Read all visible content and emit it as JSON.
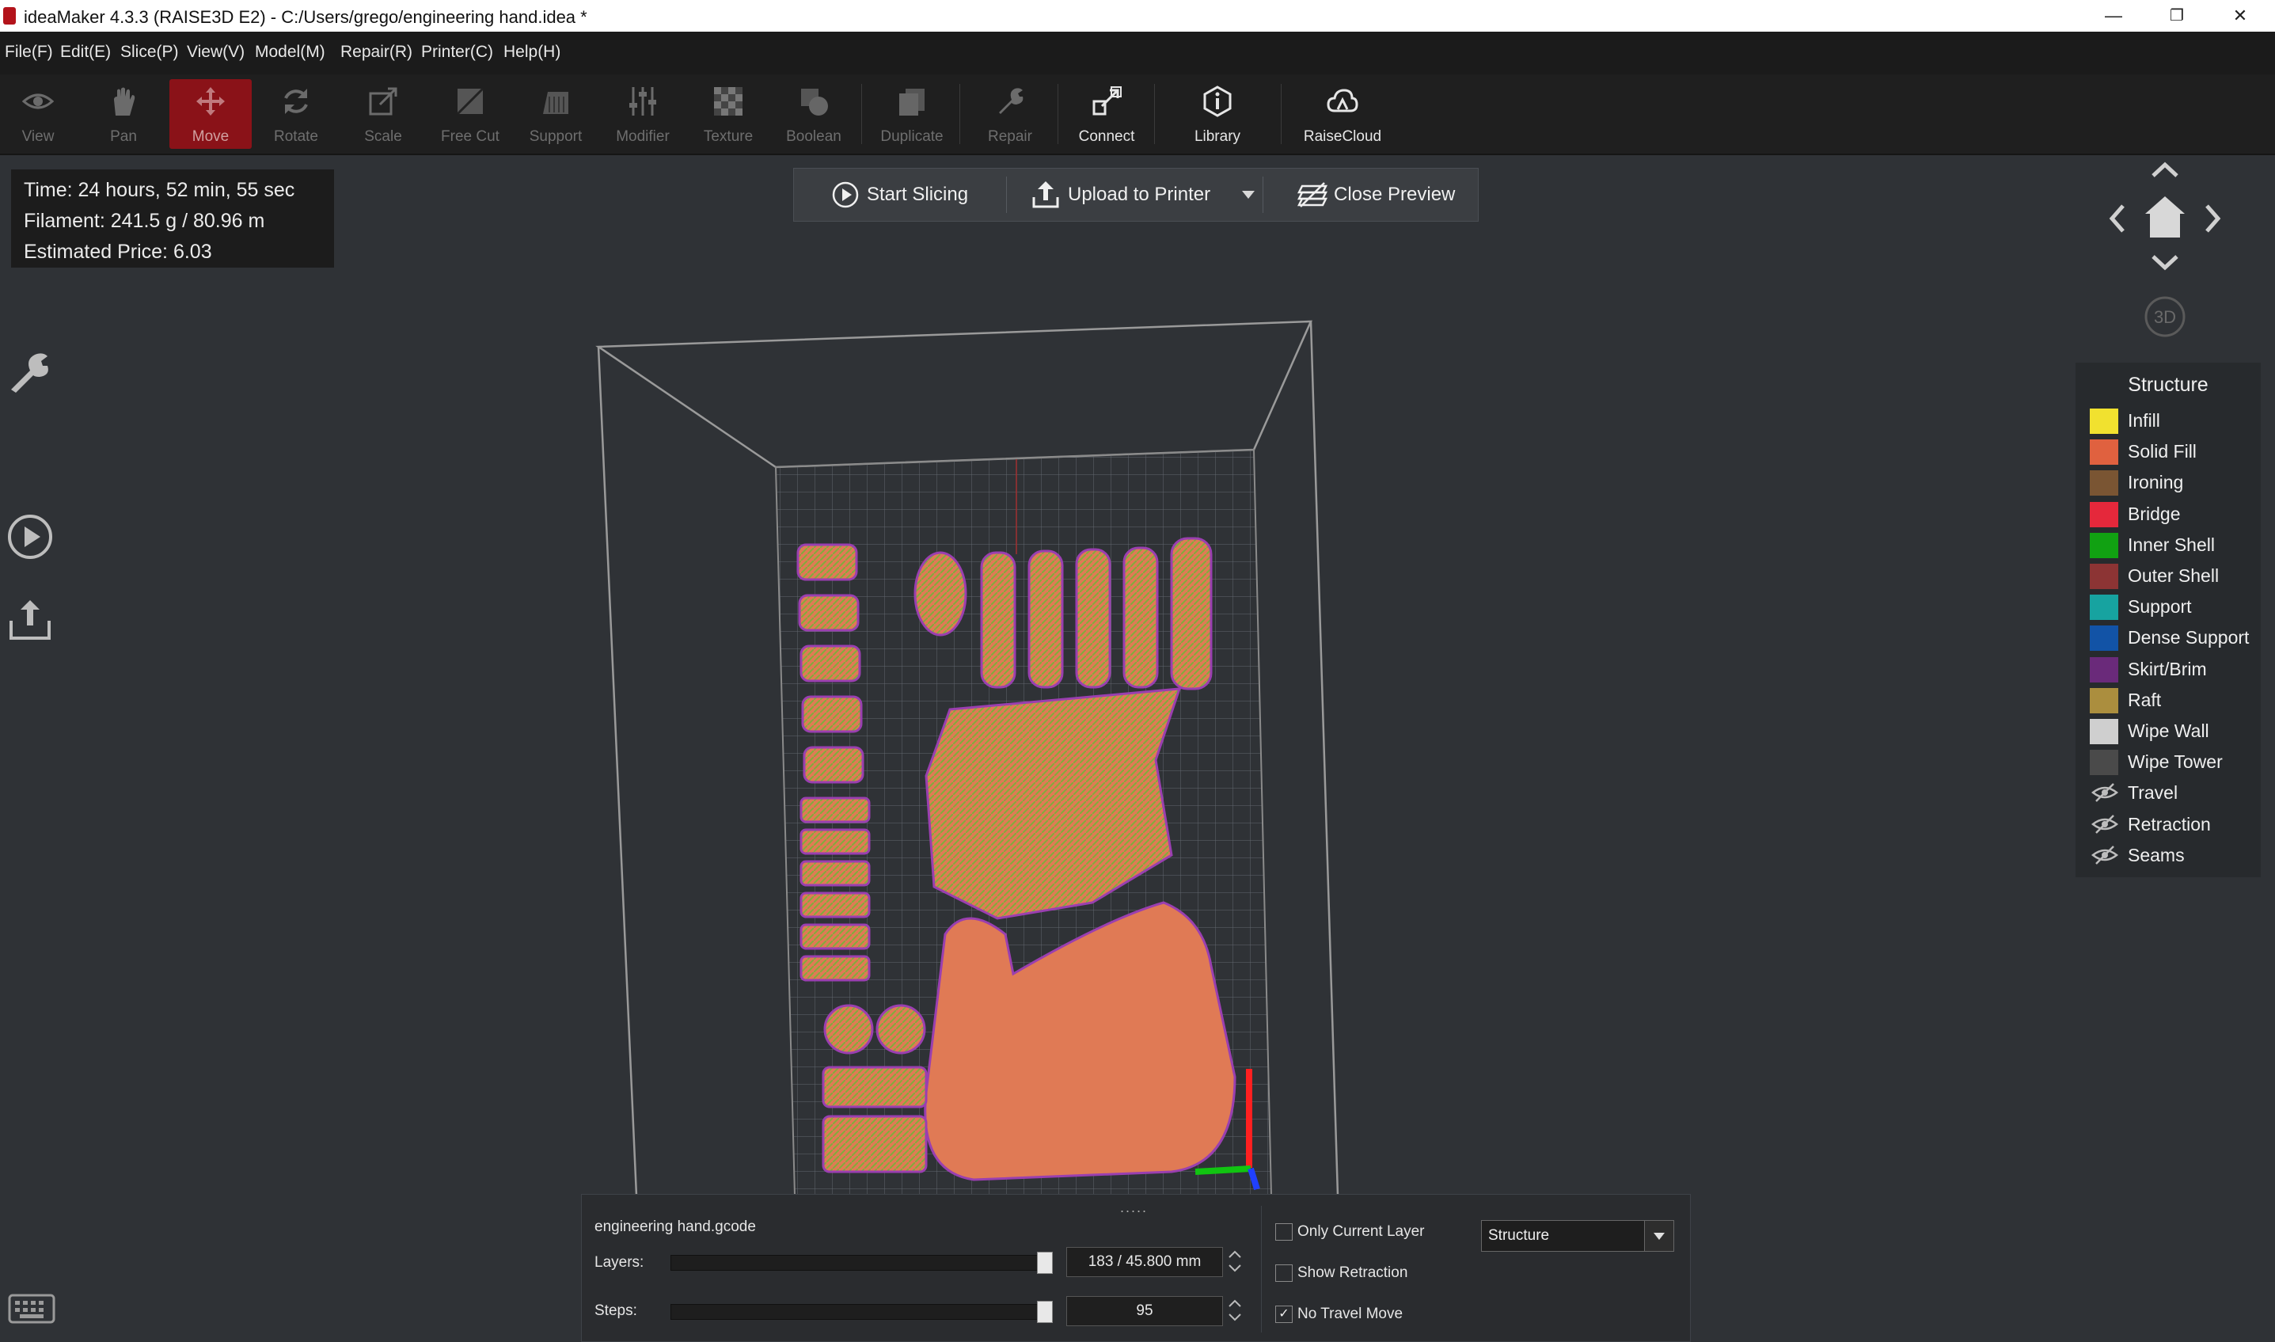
{
  "window": {
    "title": "ideaMaker 4.3.3 (RAISE3D E2) - C:/Users/grego/engineering hand.idea *",
    "minimize": "—",
    "maximize": "❐",
    "close": "✕"
  },
  "menu": [
    "File(F)",
    "Edit(E)",
    "Slice(P)",
    "View(V)",
    "Model(M)",
    "Repair(R)",
    "Printer(C)",
    "Help(H)"
  ],
  "toolbar": {
    "view": "View",
    "pan": "Pan",
    "move": "Move",
    "rotate": "Rotate",
    "scale": "Scale",
    "free_cut": "Free Cut",
    "support": "Support",
    "modifier": "Modifier",
    "texture": "Texture",
    "boolean": "Boolean",
    "duplicate": "Duplicate",
    "repair": "Repair",
    "connect": "Connect",
    "library": "Library",
    "raisecloud": "RaiseCloud",
    "active_tool": "Move"
  },
  "info": {
    "time": "Time: 24 hours, 52 min, 55 sec",
    "filament": "Filament: 241.5 g / 80.96 m",
    "price": "Estimated Price: 6.03"
  },
  "slicebar": {
    "start": "Start Slicing",
    "upload": "Upload to Printer",
    "close": "Close Preview"
  },
  "navcube": {
    "label3d": "3D"
  },
  "legend": {
    "title": "Structure",
    "items": [
      {
        "name": "Infill",
        "color": "#f1e12f"
      },
      {
        "name": "Solid Fill",
        "color": "#e0613f"
      },
      {
        "name": "Ironing",
        "color": "#7a5533"
      },
      {
        "name": "Bridge",
        "color": "#e5283b"
      },
      {
        "name": "Inner Shell",
        "color": "#11a112"
      },
      {
        "name": "Outer Shell",
        "color": "#8c3434"
      },
      {
        "name": "Support",
        "color": "#17a3a0"
      },
      {
        "name": "Dense Support",
        "color": "#1253a6"
      },
      {
        "name": "Skirt/Brim",
        "color": "#6a2a7a"
      },
      {
        "name": "Raft",
        "color": "#ab8e3e"
      },
      {
        "name": "Wipe Wall",
        "color": "#cfcfcf"
      },
      {
        "name": "Wipe Tower",
        "color": "#4a4a4a"
      }
    ],
    "hidden_items": [
      "Travel",
      "Retraction",
      "Seams"
    ]
  },
  "preview": {
    "filename": "engineering hand.gcode",
    "layers_label": "Layers:",
    "layers_value": "183 / 45.800 mm",
    "layers_fraction": 1.0,
    "steps_label": "Steps:",
    "steps_value": "95",
    "steps_fraction": 1.0,
    "only_current_layer": "Only Current Layer",
    "show_retraction": "Show Retraction",
    "no_travel_move": "No Travel Move",
    "only_current_layer_checked": false,
    "show_retraction_checked": false,
    "no_travel_move_checked": true,
    "view_mode": "Structure",
    "grip": "....."
  }
}
